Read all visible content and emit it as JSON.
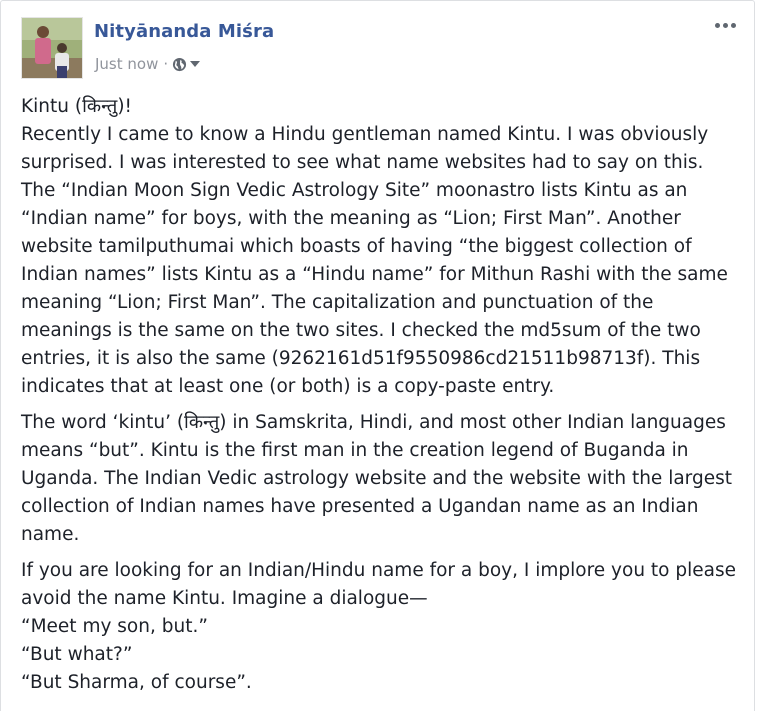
{
  "post": {
    "author": "Nityānanda Miśra",
    "timestamp": "Just now",
    "separator": "·",
    "privacy_icon": "globe-icon",
    "audience_dropdown_icon": "caret-down-icon",
    "more_icon": "ellipsis-icon",
    "paragraphs": [
      {
        "lines": [
          "Kintu (किन्तु)!",
          "Recently I came to know a Hindu gentleman named Kintu. I was obviously",
          "surprised. I was interested to see what name websites had to say on this.",
          "The “Indian Moon Sign Vedic Astrology Site” moonastro lists Kintu as an",
          "“Indian name” for boys, with the meaning as “Lion; First Man”. Another",
          "website tamilputhumai which boasts of having “the biggest collection of",
          "Indian names” lists Kintu as a “Hindu name” for Mithun Rashi with the same",
          "meaning “Lion; First Man”. The capitalization and punctuation of the",
          "meanings is the same on the two sites. I checked the md5sum of the two",
          "entries, it is also the same (9262161d51f9550986cd21511b98713f). This",
          "indicates that at least one (or both) is a copy-paste entry."
        ]
      },
      {
        "lines": [
          "The word ‘kintu’ (किन्तु) in Samskrita, Hindi, and most other Indian languages",
          "means “but”. Kintu is the first man in the creation legend of Buganda in",
          "Uganda. The Indian Vedic astrology website and the website with the largest",
          "collection of Indian names have presented a Ugandan name as an Indian",
          "name."
        ]
      },
      {
        "lines": [
          "If you are looking for an Indian/Hindu name for a boy, I implore you to please",
          "avoid the name Kintu. Imagine a dialogue—",
          "“Meet my son, but.”",
          "“But what?”",
          "“But Sharma, of course”."
        ]
      }
    ]
  },
  "colors": {
    "author_link": "#385898",
    "meta_text": "#90949c",
    "body_text": "#1d2129",
    "border": "#dddfe2"
  }
}
